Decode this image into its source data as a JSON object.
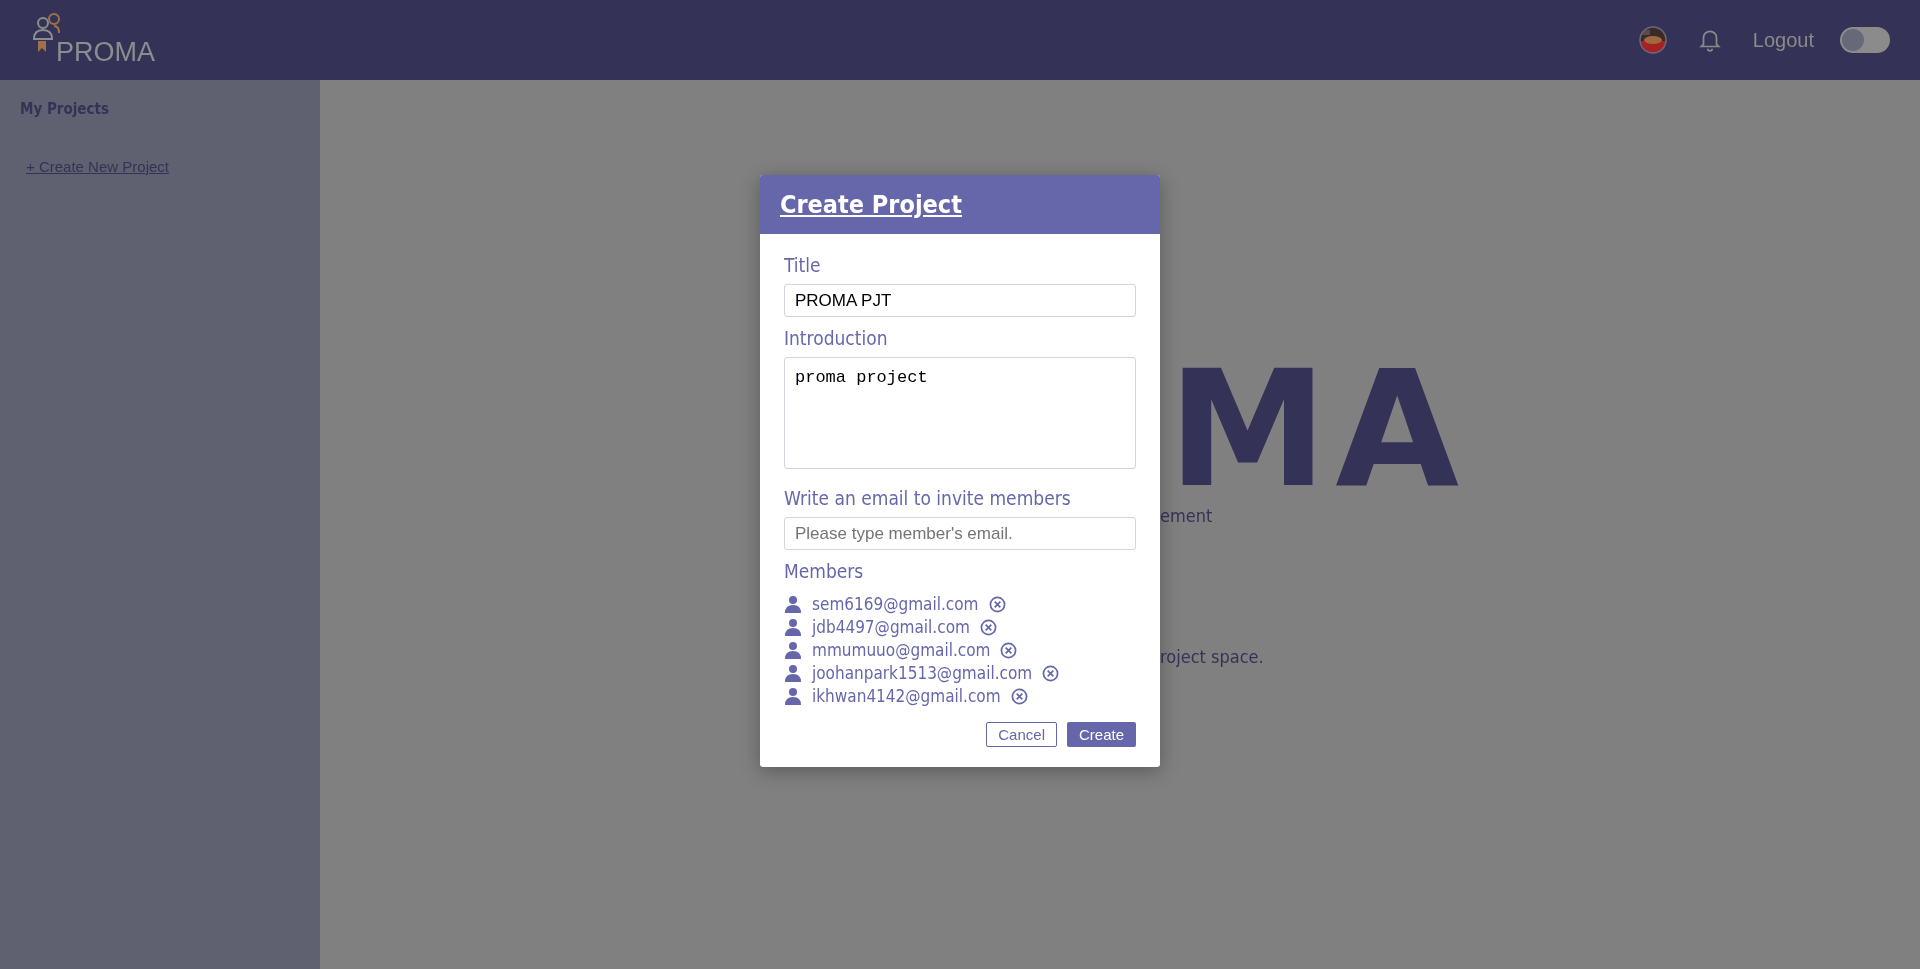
{
  "header": {
    "logo": "PROMA",
    "logout": "Logout",
    "theme_toggle": {
      "on": false
    }
  },
  "sidebar": {
    "title": "My Projects",
    "create_link": "+ Create New Project"
  },
  "hero": {
    "title": "MA",
    "line_1": "ement",
    "line_2": "roject space."
  },
  "modal": {
    "title": "Create Project",
    "title_label": "Title",
    "title_value": "PROMA PJT",
    "intro_label": "Introduction",
    "intro_value": "proma project",
    "invite_label": "Write an email to invite members",
    "invite_placeholder": "Please type member's email.",
    "members_label": "Members",
    "members": [
      {
        "email": "sem6169@gmail.com"
      },
      {
        "email": "jdb4497@gmail.com"
      },
      {
        "email": "mmumuuo@gmail.com"
      },
      {
        "email": "joohanpark1513@gmail.com"
      },
      {
        "email": "ikhwan4142@gmail.com"
      }
    ],
    "cancel": "Cancel",
    "create": "Create"
  }
}
